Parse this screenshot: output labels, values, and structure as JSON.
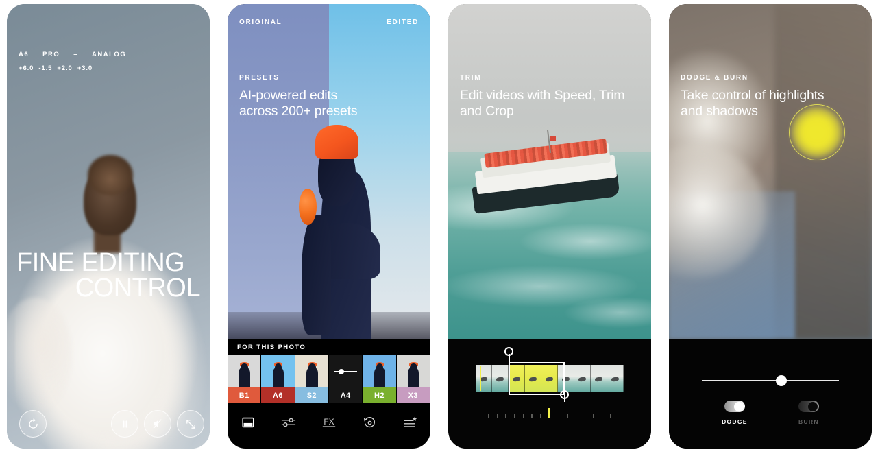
{
  "panels": [
    {
      "id": "fine-editing-control",
      "meta_row1": [
        "A6",
        "PRO",
        "–",
        "ANALOG"
      ],
      "meta_row2": [
        "+6.0",
        "-1.5",
        "+2.0",
        "+3.0"
      ],
      "title_line1": "FINE EDITING",
      "title_line2": "CONTROL",
      "controls": [
        {
          "name": "replay-button",
          "icon": "replay-icon"
        },
        {
          "name": "pause-button",
          "icon": "pause-icon"
        },
        {
          "name": "mute-button",
          "icon": "mute-icon"
        },
        {
          "name": "fullscreen-button",
          "icon": "expand-icon"
        }
      ]
    },
    {
      "id": "presets",
      "label_original": "ORIGINAL",
      "label_edited": "EDITED",
      "kicker": "PRESETS",
      "headline_line1": "AI-powered edits",
      "headline_line2": "across 200+ presets",
      "strip_label": "FOR THIS PHOTO",
      "presets": [
        {
          "code": "B1",
          "color": "#e05a3c",
          "selected": false
        },
        {
          "code": "A6",
          "color": "#b33028",
          "selected": false
        },
        {
          "code": "S2",
          "color": "#87bde0",
          "selected": false
        },
        {
          "code": "A4",
          "color": "#161616",
          "selected": true
        },
        {
          "code": "H2",
          "color": "#7ab02e",
          "selected": false
        },
        {
          "code": "X3",
          "color": "#c79cc0",
          "selected": false
        }
      ],
      "toolbar": [
        {
          "name": "tab-presets",
          "icon": "presets-icon",
          "label": "Presets"
        },
        {
          "name": "tab-adjust",
          "icon": "sliders-icon",
          "label": "Adjust"
        },
        {
          "name": "tab-fx",
          "icon": "fx-icon",
          "label": "FX"
        },
        {
          "name": "tab-history",
          "icon": "history-icon",
          "label": "History"
        },
        {
          "name": "tab-recipes",
          "icon": "recipes-star-icon",
          "label": "Recipes"
        }
      ]
    },
    {
      "id": "trim",
      "kicker": "TRIM",
      "headline_line1": "Edit videos with Speed, Trim",
      "headline_line2": "and Crop",
      "timeline": {
        "frame_count": 9,
        "selected_frames": [
          2,
          3,
          4
        ],
        "ruler_ticks": 15,
        "playhead_tick_index": 7
      }
    },
    {
      "id": "dodge-burn",
      "kicker": "DODGE & BURN",
      "headline_line1": "Take control of highlights",
      "headline_line2": "and shadows",
      "slider_value_percent": 58,
      "toggles": [
        {
          "label": "DODGE",
          "state": "on"
        },
        {
          "label": "BURN",
          "state": "off"
        }
      ]
    }
  ],
  "colors": {
    "accent_yellow": "#f0e92c",
    "panel_black": "#000000",
    "text_white": "#ffffff"
  }
}
